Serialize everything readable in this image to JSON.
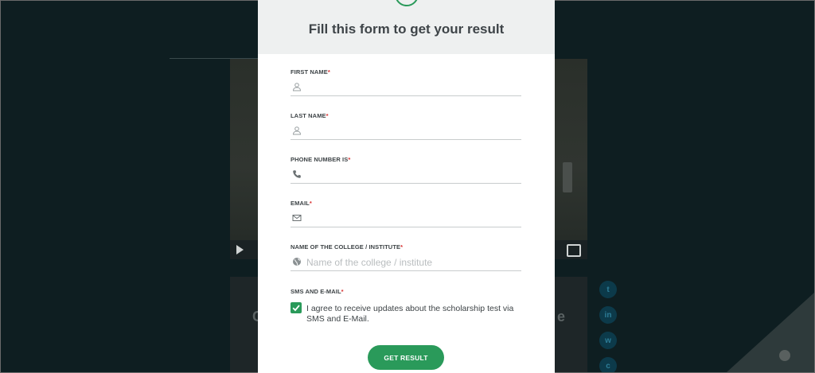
{
  "modal": {
    "title": "Fill this form to get your result",
    "fields": [
      {
        "label": "FIRST NAME",
        "required": "*",
        "icon": "user-icon",
        "value": "",
        "placeholder": ""
      },
      {
        "label": "LAST NAME",
        "required": "*",
        "icon": "user-icon",
        "value": "",
        "placeholder": ""
      },
      {
        "label": "PHONE NUMBER IS",
        "required": "*",
        "icon": "phone-icon",
        "value": "",
        "placeholder": ""
      },
      {
        "label": "EMAIL",
        "required": "*",
        "icon": "mail-icon",
        "value": "",
        "placeholder": ""
      },
      {
        "label": "NAME OF THE COLLEGE / INSTITUTE",
        "required": "*",
        "icon": "globe-icon",
        "value": "",
        "placeholder": "Name of the college / institute"
      }
    ],
    "consent": {
      "label": "SMS AND E-MAIL",
      "required": "*",
      "checked": true,
      "text": "I agree to receive updates about the scholarship test via SMS and E-Mail."
    },
    "submit_label": "GET RESULT"
  },
  "background": {
    "card_text_left": "C",
    "card_text_right": "e"
  },
  "social": {
    "twitter": "t",
    "linkedin": "in",
    "whatsapp": "w",
    "chat": "c"
  },
  "colors": {
    "accent": "#2a9a5a",
    "required": "#d83030",
    "overlay": "#0e1e21"
  }
}
